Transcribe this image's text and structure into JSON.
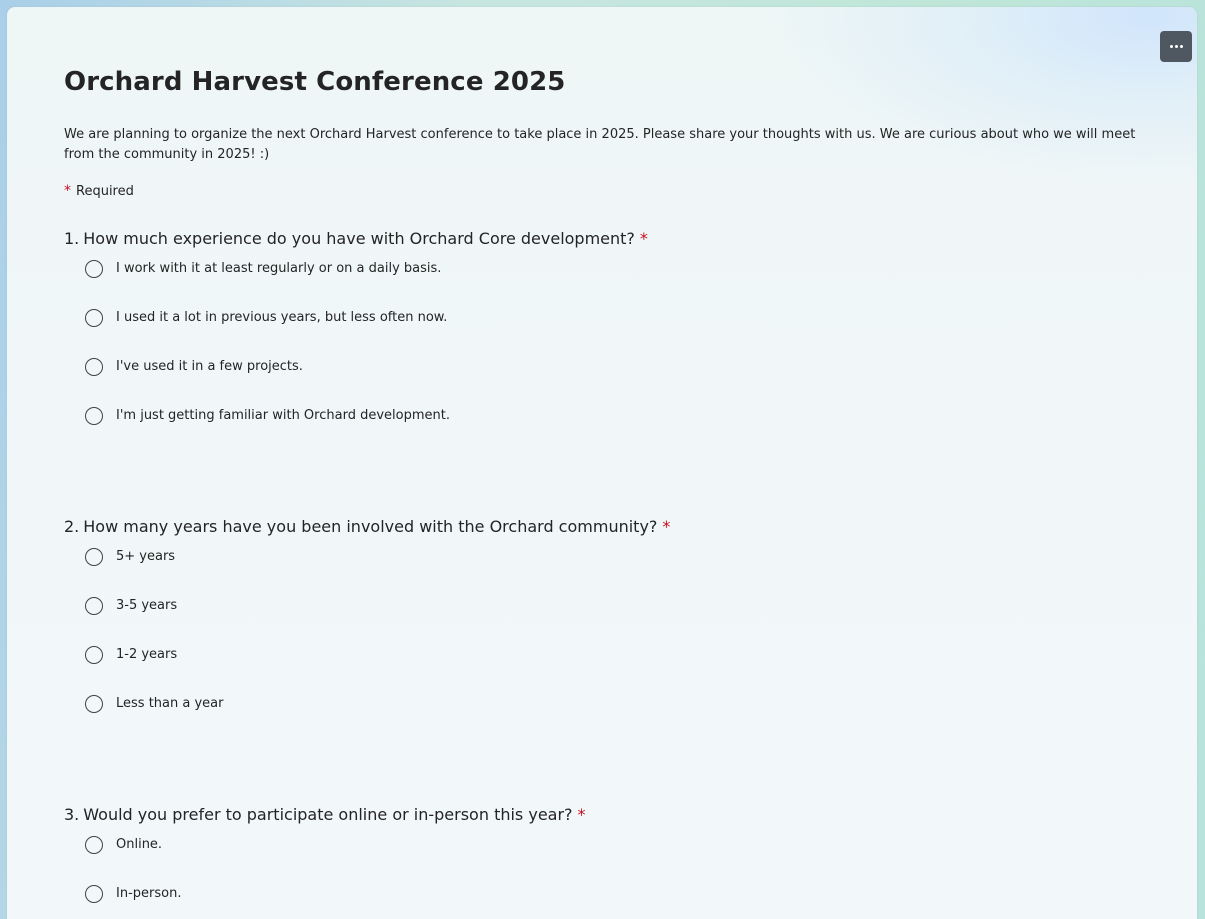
{
  "form": {
    "title": "Orchard Harvest Conference 2025",
    "description": "We are planning to organize the next Orchard Harvest conference to take place in 2025. Please share your thoughts with us. We are curious about who we will meet from the community in 2025! :)",
    "required_star": "*",
    "required_label": "Required",
    "more_icon": "more-horizontal-icon"
  },
  "questions": [
    {
      "number": "1.",
      "text": "How much experience do you have with Orchard Core development?",
      "required": "*",
      "options": [
        "I work with it at least regularly or on a daily basis.",
        "I used it a lot in previous years, but less often now.",
        "I've used it in a few projects.",
        "I'm just getting familiar with Orchard development."
      ]
    },
    {
      "number": "2.",
      "text": "How many years have you been involved with the Orchard community?",
      "required": "*",
      "options": [
        "5+ years",
        "3-5 years",
        "1-2 years",
        "Less than a year"
      ]
    },
    {
      "number": "3.",
      "text": "Would you prefer to participate online or in-person this year?",
      "required": "*",
      "options": [
        "Online.",
        "In-person."
      ]
    }
  ],
  "colors": {
    "required_star": "#c50f1f",
    "more_button_bg": "#4f5861",
    "text": "#242424"
  }
}
